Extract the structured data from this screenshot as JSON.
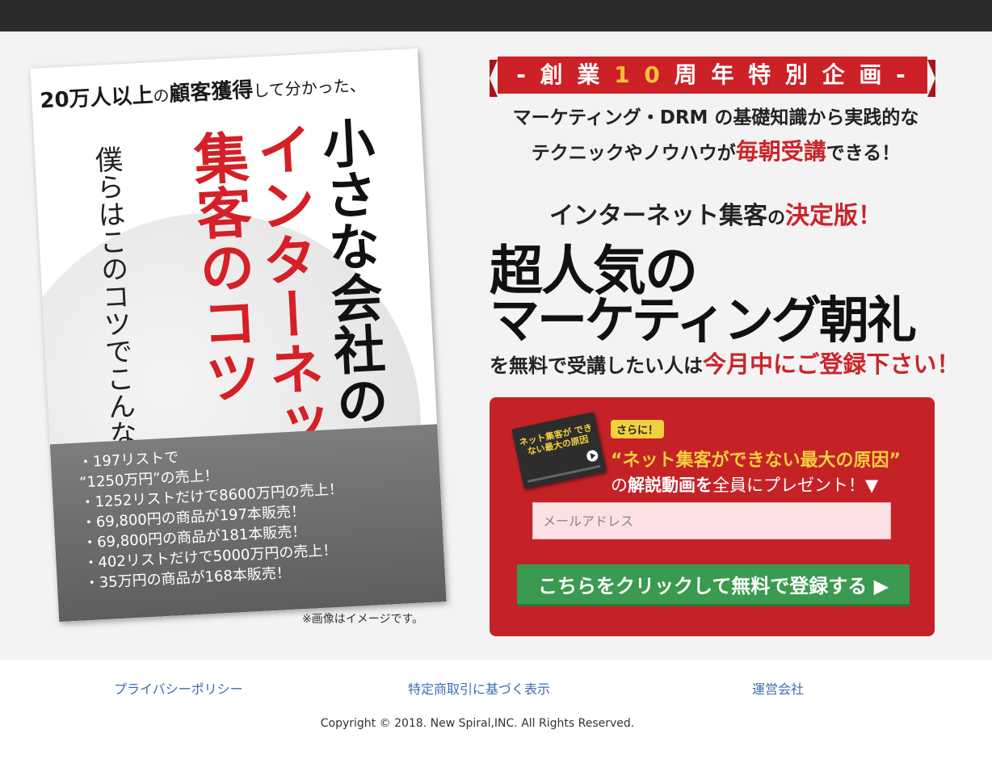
{
  "book": {
    "headline_a": "20万人以上",
    "headline_b": "の",
    "headline_c": "顧客獲得",
    "headline_d": "して分かった、",
    "vertical_small": "僕らはこのコツでこんな結果が誕生！",
    "vertical_red_1": "集客のコツ",
    "vertical_red_2": "インターネット",
    "vertical_black": "小さな会社の",
    "results": [
      "・197リストで",
      "“1250万円”の売上！",
      "・1252リストだけで8600万円の売上！",
      "・69,800円の商品が197本販売！",
      "・69,800円の商品が181本販売！",
      "・402リストだけで5000万円の売上！",
      "・35万円の商品が168本販売！"
    ],
    "note": "※画像はイメージです。"
  },
  "ribbon": {
    "left": "- 創 業 ",
    "number": "1 0",
    "right": " 周 年 特 別 企 画 -"
  },
  "lead": {
    "line1": "マーケティング・DRM の基礎知識から実践的な",
    "line2_a": "テクニックやノウハウが",
    "line2_red": "毎朝受講",
    "line2_b": "できる！"
  },
  "headline": {
    "sub_a": "インターネット集客",
    "sub_b": "の",
    "sub_red": "決定版！",
    "big1": "超人気の",
    "big2": "マーケティング朝礼",
    "register_a": "を無料で受講したい人は",
    "register_red": "今月中にご登録下さい！"
  },
  "panel": {
    "video_caption": "ネット集客が できない最大の原因",
    "badge": "さらに！",
    "gift_title": "“ネット集客ができない最大の原因”",
    "gift_a": "の",
    "gift_b": "解説動画を",
    "gift_c": "全員にプレゼント！▼",
    "email_placeholder": "メールアドレス",
    "email_value": "",
    "submit_label": "こちらをクリックして無料で登録する ▶"
  },
  "footer": {
    "links": [
      "プライバシーポリシー",
      "特定商取引に基づく表示",
      "運営会社"
    ],
    "copyright": "Copyright © 2018. New Spiral,INC. All Rights Reserved."
  },
  "colors": {
    "accent_red": "#c52227",
    "yellow": "#f4d03f",
    "button_green": "#3a9a4f",
    "topbar": "#2b2b2b",
    "link_blue": "#3b6db3"
  }
}
